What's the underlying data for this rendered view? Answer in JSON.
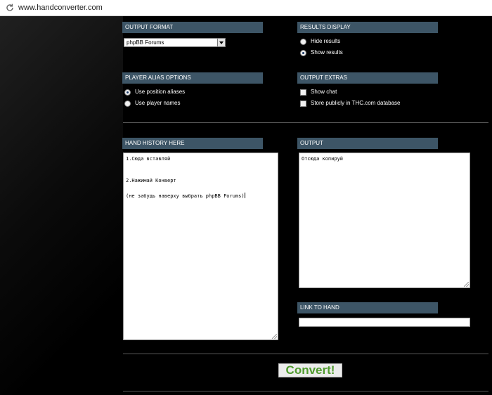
{
  "browser": {
    "url": "www.handconverter.com"
  },
  "output_format": {
    "header": "OUTPUT FORMAT",
    "selected": "phpBB Forums"
  },
  "results_display": {
    "header": "RESULTS DISPLAY",
    "options": [
      {
        "label": "Hide results",
        "checked": false
      },
      {
        "label": "Show results",
        "checked": true
      }
    ]
  },
  "player_alias": {
    "header": "PLAYER ALIAS OPTIONS",
    "options": [
      {
        "label": "Use position aliases",
        "checked": true
      },
      {
        "label": "Use player names",
        "checked": false
      }
    ]
  },
  "output_extras": {
    "header": "OUTPUT EXTRAS",
    "options": [
      {
        "label": "Show chat",
        "checked": false
      },
      {
        "label": "Store publicly in THC.com database",
        "checked": false
      }
    ]
  },
  "hand_history": {
    "header": "HAND HISTORY HERE",
    "lines": [
      "1.Сюда вставляй",
      "2.Нажимай Конверт",
      "(не забудь наверху выбрать phpBB Forums)"
    ]
  },
  "output": {
    "header": "OUTPUT",
    "text": "Отсюда копируй"
  },
  "link_to_hand": {
    "header": "LINK TO HAND",
    "value": ""
  },
  "convert_button": {
    "label": "Convert!"
  },
  "icons": {
    "reload": "reload-icon",
    "dropdown": "chevron-down-icon",
    "resize": "resize-grip-icon"
  }
}
